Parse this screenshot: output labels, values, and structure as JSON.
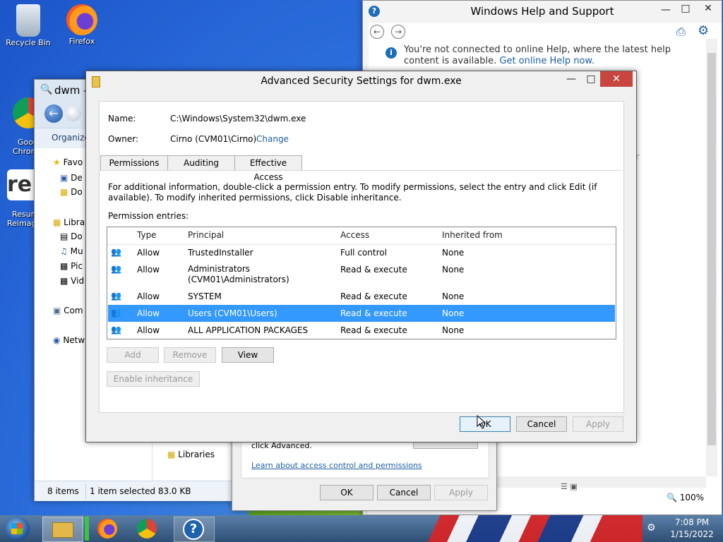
{
  "desktop": {
    "icons": [
      {
        "label": "Recycle Bin"
      },
      {
        "label": "Firefox"
      },
      {
        "label": "Goog\nChron"
      },
      {
        "label": "Resur\nReimag"
      }
    ]
  },
  "help_window": {
    "title": "Windows Help and Support",
    "notice_text": "You're not connected to online Help, where the latest help content is available.",
    "notice_link": "Get online Help now.",
    "partial_text": "r",
    "zoom": "100%"
  },
  "explorer": {
    "title": "dwm -",
    "organize": "Organize",
    "nav": [
      {
        "label": "Favo"
      },
      {
        "label": "De"
      },
      {
        "label": "Do"
      },
      {
        "label": "Libra"
      },
      {
        "label": "Do"
      },
      {
        "label": "Mu"
      },
      {
        "label": "Pic"
      },
      {
        "label": "Vid"
      },
      {
        "label": "Com"
      },
      {
        "label": "Netw"
      }
    ],
    "status_items": "8 items",
    "status_selected": "1 item selected  83.0 KB",
    "libraries": "Libraries"
  },
  "props_dialog": {
    "text": "click Advanced.",
    "link": "Learn about access control and permissions",
    "ok": "OK",
    "cancel": "Cancel",
    "apply": "Apply"
  },
  "adv_dialog": {
    "title": "Advanced Security Settings for dwm.exe",
    "name_label": "Name:",
    "name_value": "C:\\Windows\\System32\\dwm.exe",
    "owner_label": "Owner:",
    "owner_value": "Cirno (CVM01\\Cirno)",
    "owner_change": "Change",
    "tabs": [
      "Permissions",
      "Auditing",
      "Effective Access"
    ],
    "info_text": "For additional information, double-click a permission entry. To modify permissions, select the entry and click Edit (if available). To modify inherited permissions, click Disable inheritance.",
    "entries_label": "Permission entries:",
    "columns": [
      "Type",
      "Principal",
      "Access",
      "Inherited from"
    ],
    "rows": [
      {
        "type": "Allow",
        "principal": "TrustedInstaller",
        "access": "Full control",
        "inherited": "None"
      },
      {
        "type": "Allow",
        "principal": "Administrators (CVM01\\Administrators)",
        "access": "Read & execute",
        "inherited": "None"
      },
      {
        "type": "Allow",
        "principal": "SYSTEM",
        "access": "Read & execute",
        "inherited": "None"
      },
      {
        "type": "Allow",
        "principal": "Users (CVM01\\Users)",
        "access": "Read & execute",
        "inherited": "None"
      },
      {
        "type": "Allow",
        "principal": "ALL APPLICATION PACKAGES",
        "access": "Read & execute",
        "inherited": "None"
      }
    ],
    "selected_row": 3,
    "add": "Add",
    "remove": "Remove",
    "view": "View",
    "enable_inheritance": "Enable inheritance",
    "ok": "OK",
    "cancel": "Cancel",
    "apply": "Apply"
  },
  "taskbar": {
    "time": "7:08 PM",
    "date": "1/15/2022"
  }
}
